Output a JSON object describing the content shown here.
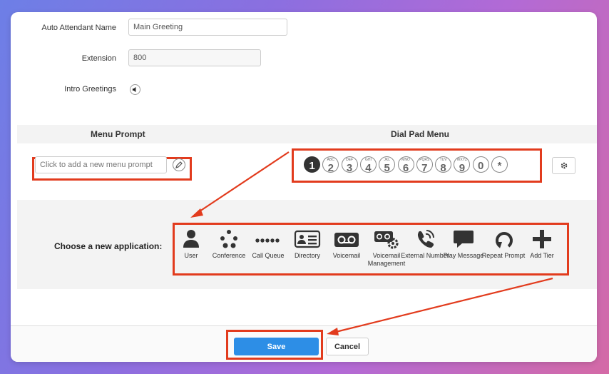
{
  "form": {
    "name_label": "Auto Attendant Name",
    "name_value": "Main Greeting",
    "extension_label": "Extension",
    "extension_value": "800",
    "intro_label": "Intro Greetings"
  },
  "headers": {
    "menu_prompt": "Menu Prompt",
    "dial_pad_menu": "Dial Pad Menu"
  },
  "menu_prompt": {
    "placeholder": "Click to add a new menu prompt"
  },
  "dial_pad": {
    "keys": [
      {
        "num": "1",
        "letters": ""
      },
      {
        "num": "2",
        "letters": "ABC"
      },
      {
        "num": "3",
        "letters": "DEF"
      },
      {
        "num": "4",
        "letters": "GHI"
      },
      {
        "num": "5",
        "letters": "JKL"
      },
      {
        "num": "6",
        "letters": "MNO"
      },
      {
        "num": "7",
        "letters": "PQRS"
      },
      {
        "num": "8",
        "letters": "TUV"
      },
      {
        "num": "9",
        "letters": "WXYZ"
      },
      {
        "num": "0",
        "letters": ""
      },
      {
        "num": "*",
        "letters": ""
      }
    ],
    "selected": "1"
  },
  "applications": {
    "title": "Choose a new application:",
    "items": [
      {
        "label": "User",
        "icon": "user-icon"
      },
      {
        "label": "Conference",
        "icon": "conference-icon"
      },
      {
        "label": "Call Queue",
        "icon": "call-queue-icon"
      },
      {
        "label": "Directory",
        "icon": "directory-icon"
      },
      {
        "label": "Voicemail",
        "icon": "voicemail-icon"
      },
      {
        "label": "Voicemail Management",
        "icon": "voicemail-management-icon"
      },
      {
        "label": "External Number",
        "icon": "external-number-icon"
      },
      {
        "label": "Play Message",
        "icon": "play-message-icon"
      },
      {
        "label": "Repeat Prompt",
        "icon": "repeat-prompt-icon"
      },
      {
        "label": "Add Tier",
        "icon": "add-tier-icon"
      }
    ]
  },
  "footer": {
    "save_label": "Save",
    "cancel_label": "Cancel"
  },
  "colors": {
    "highlight": "#e23b1d",
    "save_button": "#2d8ee6"
  }
}
